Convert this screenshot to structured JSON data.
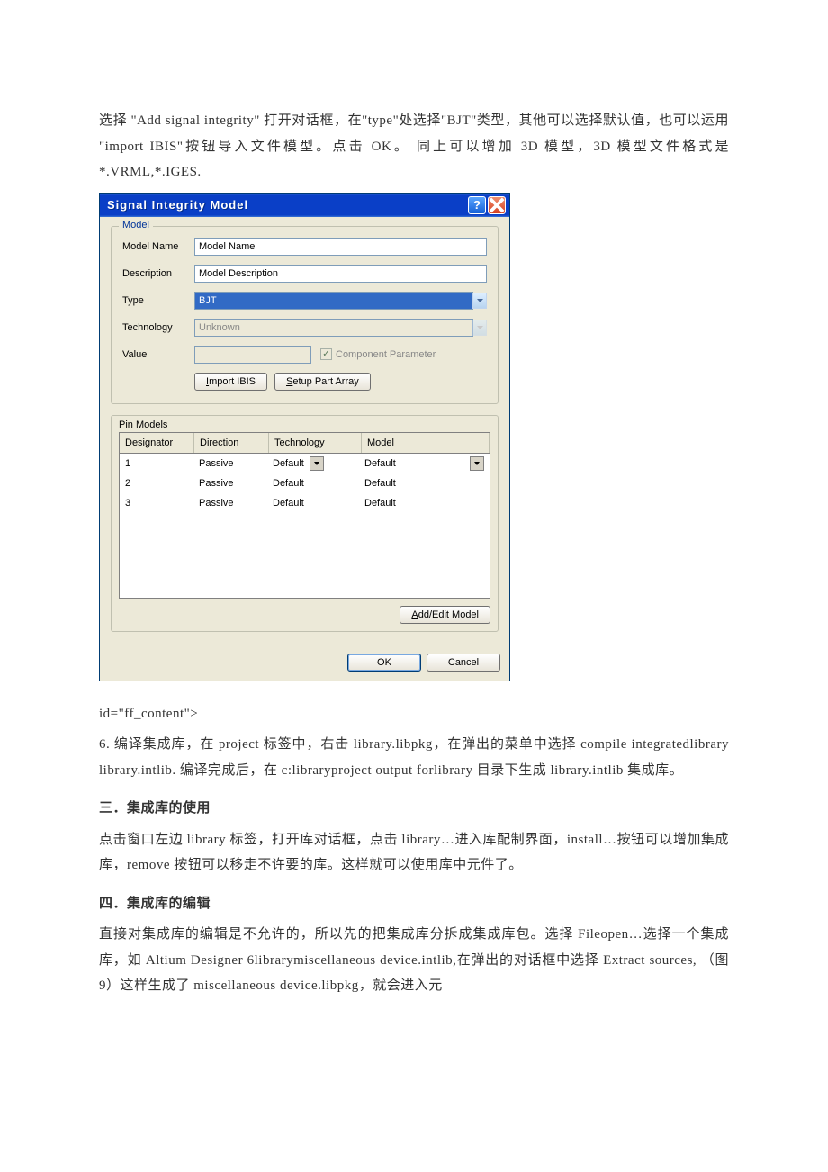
{
  "doc": {
    "p1": "选择 \"Add signal integrity\" 打开对话框，在\"type\"处选择\"BJT\"类型，其他可以选择默认值，也可以运用 \"import IBIS\"按钮导入文件模型。点击 OK。 同上可以增加 3D 模型，3D 模型文件格式是*.VRML,*.IGES.",
    "p2": "id=\"ff_content\">",
    "p3": "6.  编译集成库，在 project 标签中，右击 library.libpkg，在弹出的菜单中选择 compile integratedlibrary library.intlib. 编译完成后，在 c:libraryproject output forlibrary 目录下生成 library.intlib 集成库。",
    "h3": "三．集成库的使用",
    "p4": "点击窗口左边 library 标签，打开库对话框，点击 library…进入库配制界面，install…按钮可以增加集成库，remove 按钮可以移走不许要的库。这样就可以使用库中元件了。",
    "h4": "四．集成库的编辑",
    "p5": "直接对集成库的编辑是不允许的，所以先的把集成库分拆成集成库包。选择 Fileopen…选择一个集成库，如 Altium Designer 6librarymiscellaneous device.intlib,在弹出的对话框中选择 Extract sources, （图 9）这样生成了 miscellaneous device.libpkg，就会进入元"
  },
  "dialog": {
    "title": "Signal Integrity Model",
    "group1_title": "Model",
    "labels": {
      "model_name": "Model Name",
      "description": "Description",
      "type": "Type",
      "technology": "Technology",
      "value": "Value",
      "component_parameter": "Component Parameter"
    },
    "fields": {
      "model_name": "Model Name",
      "description": "Model Description",
      "type": "BJT",
      "technology": "Unknown",
      "value": ""
    },
    "buttons": {
      "import_ibis": "Import IBIS",
      "setup_array": "Setup Part Array",
      "add_edit": "Add/Edit Model",
      "ok": "OK",
      "cancel": "Cancel"
    },
    "pin_title": "Pin Models",
    "grid": {
      "headers": [
        "Designator",
        "Direction",
        "Technology",
        "Model"
      ],
      "rows": [
        {
          "des": "1",
          "dir": "Passive",
          "tech": "Default",
          "model": "Default",
          "sel": true
        },
        {
          "des": "2",
          "dir": "Passive",
          "tech": "Default",
          "model": "Default",
          "sel": false
        },
        {
          "des": "3",
          "dir": "Passive",
          "tech": "Default",
          "model": "Default",
          "sel": false
        }
      ]
    }
  }
}
